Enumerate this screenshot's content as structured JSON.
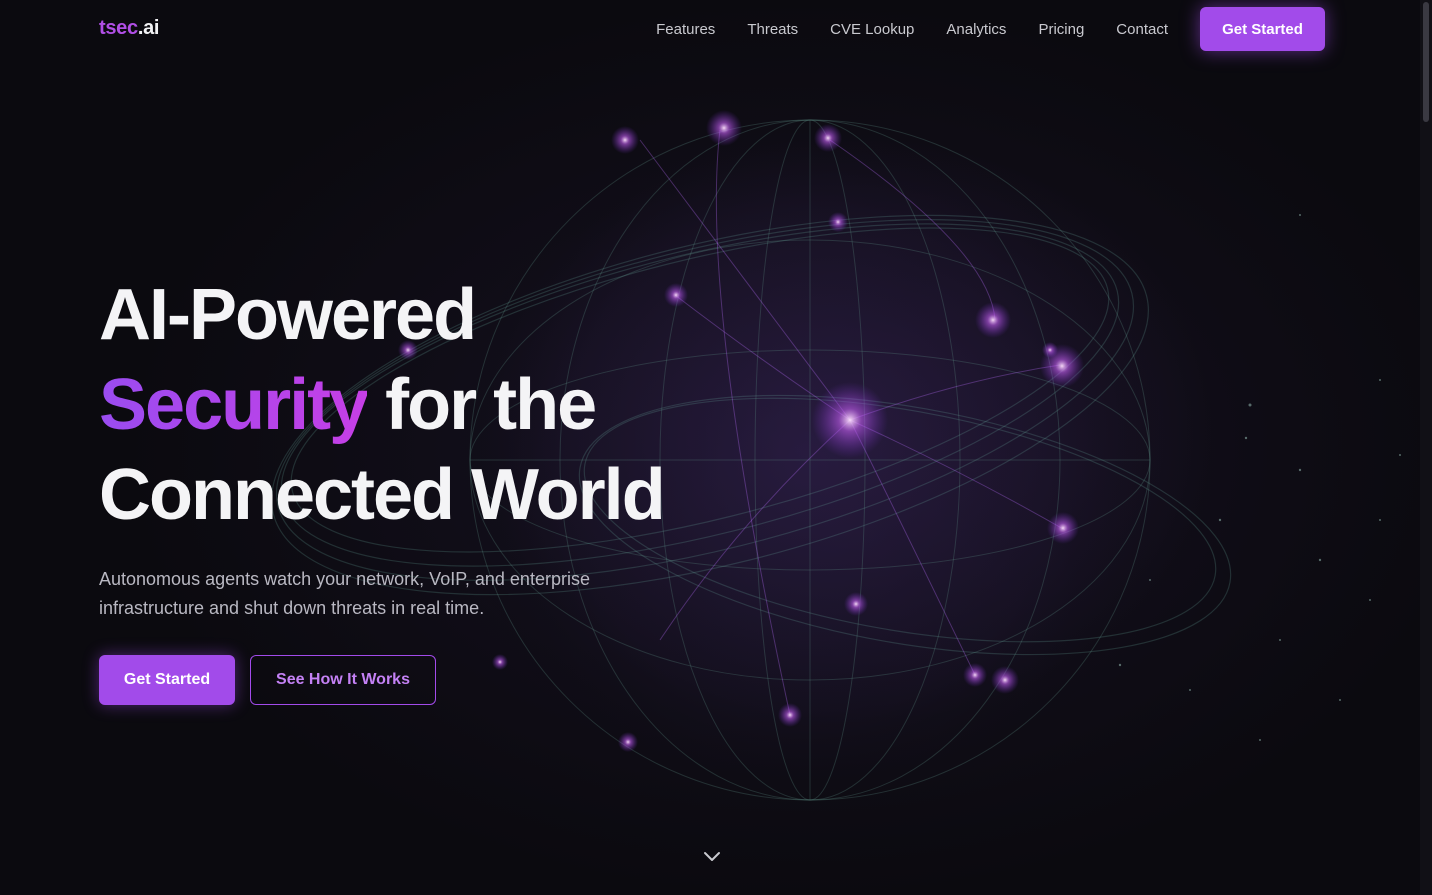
{
  "brand": {
    "logo_part1": "tsec",
    "logo_part2": ".ai",
    "accent_color": "#a24bea"
  },
  "nav": {
    "links": [
      "Features",
      "Threats",
      "CVE Lookup",
      "Analytics",
      "Pricing",
      "Contact"
    ],
    "cta_label": "Get Started"
  },
  "hero": {
    "title_line1": "AI-Powered",
    "title_accent": "Security",
    "title_line2_rest": " for the",
    "title_line3": "Connected World",
    "subtitle": "Autonomous agents watch your network, VoIP, and enterprise infrastructure and shut down threats in real time.",
    "primary_button": "Get Started",
    "secondary_button": "See How It Works"
  },
  "icons": {
    "scroll_indicator": "chevron-down-icon",
    "background": "globe-network-illustration"
  }
}
